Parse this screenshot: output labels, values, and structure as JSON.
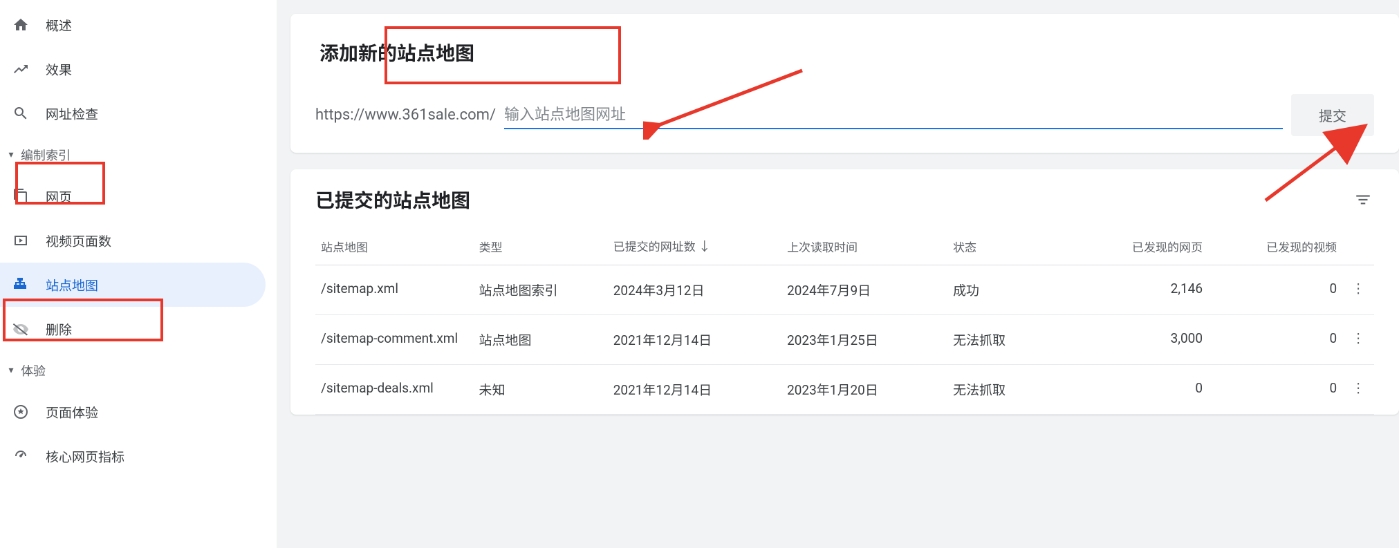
{
  "sidebar": {
    "items": [
      {
        "label": "概述",
        "icon": "home"
      },
      {
        "label": "效果",
        "icon": "trending"
      },
      {
        "label": "网址检查",
        "icon": "search"
      }
    ],
    "group_index": "编制索引",
    "index_items": [
      {
        "label": "网页",
        "icon": "pages"
      },
      {
        "label": "视频页面数",
        "icon": "video"
      },
      {
        "label": "站点地图",
        "icon": "sitemap",
        "active": true
      },
      {
        "label": "删除",
        "icon": "remove"
      }
    ],
    "group_experience": "体验",
    "exp_items": [
      {
        "label": "页面体验",
        "icon": "badge"
      },
      {
        "label": "核心网页指标",
        "icon": "speed"
      }
    ]
  },
  "add_card": {
    "title": "添加新的站点地图",
    "prefix": "https://www.361sale.com/",
    "placeholder": "输入站点地图网址",
    "submit": "提交"
  },
  "list_card": {
    "title": "已提交的站点地图",
    "columns": {
      "sitemap": "站点地图",
      "type": "类型",
      "submitted": "已提交的网址数",
      "last_read": "上次读取时间",
      "status": "状态",
      "pages": "已发现的网页",
      "videos": "已发现的视频"
    },
    "rows": [
      {
        "sitemap": "/sitemap.xml",
        "type": "站点地图索引",
        "submitted": "2024年3月12日",
        "last_read": "2024年7月9日",
        "status": "成功",
        "status_kind": "success",
        "pages": "2,146",
        "videos": "0"
      },
      {
        "sitemap": "/sitemap-comment.xml",
        "type": "站点地图",
        "submitted": "2021年12月14日",
        "last_read": "2023年1月25日",
        "status": "无法抓取",
        "status_kind": "error",
        "pages": "3,000",
        "videos": "0"
      },
      {
        "sitemap": "/sitemap-deals.xml",
        "type": "未知",
        "submitted": "2021年12月14日",
        "last_read": "2023年1月20日",
        "status": "无法抓取",
        "status_kind": "error",
        "pages": "0",
        "videos": "0"
      }
    ]
  }
}
